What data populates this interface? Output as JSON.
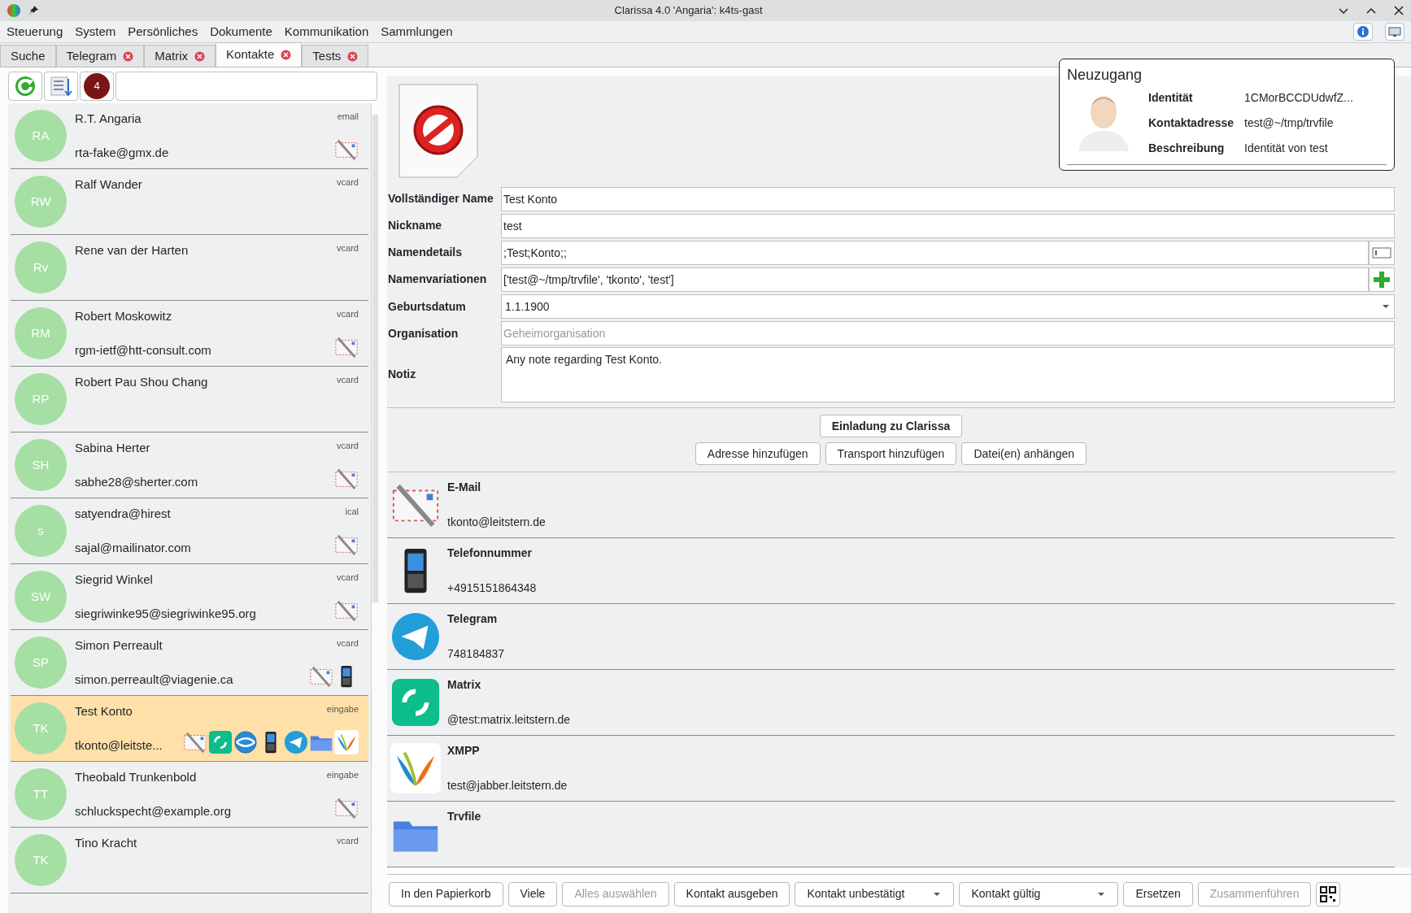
{
  "window": {
    "title": "Clarissa 4.0 'Angaria': k4ts-gast"
  },
  "menu": [
    "Steuerung",
    "System",
    "Persönliches",
    "Dokumente",
    "Kommunikation",
    "Sammlungen"
  ],
  "tabs": [
    {
      "label": "Suche",
      "closable": false,
      "selected": false
    },
    {
      "label": "Telegram",
      "closable": true,
      "selected": false
    },
    {
      "label": "Matrix",
      "closable": true,
      "selected": false
    },
    {
      "label": "Kontakte",
      "closable": true,
      "selected": true
    },
    {
      "label": "Tests",
      "closable": true,
      "selected": false
    }
  ],
  "toolbar": {
    "badge": "4"
  },
  "contacts": [
    {
      "initials": "RA",
      "name": "R.T. Angaria",
      "email": "rta-fake@gmx.de",
      "source": "email",
      "selected": false,
      "icons": [
        {
          "kind": "email"
        }
      ]
    },
    {
      "initials": "RW",
      "name": "Ralf Wander",
      "source": "vcard",
      "selected": false
    },
    {
      "initials": "Rv",
      "name": "Rene van der Harten",
      "source": "vcard",
      "selected": false
    },
    {
      "initials": "RM",
      "name": "Robert Moskowitz",
      "email": "rgm-ietf@htt-consult.com",
      "source": "vcard",
      "selected": false,
      "icons": [
        {
          "kind": "email"
        }
      ]
    },
    {
      "initials": "RP",
      "name": "Robert Pau Shou Chang",
      "source": "vcard",
      "selected": false
    },
    {
      "initials": "SH",
      "name": "Sabina Herter",
      "email": "sabhe28@sherter.com",
      "source": "vcard",
      "selected": false,
      "icons": [
        {
          "kind": "email"
        }
      ]
    },
    {
      "initials": "s",
      "name": "satyendra@hirest",
      "email": "sajal@mailinator.com",
      "source": "ical",
      "selected": false,
      "icons": [
        {
          "kind": "email"
        }
      ]
    },
    {
      "initials": "SW",
      "name": "Siegrid Winkel",
      "email": "siegriwinke95@siegriwinke95.org",
      "source": "vcard",
      "selected": false,
      "icons": [
        {
          "kind": "email"
        }
      ]
    },
    {
      "initials": "SP",
      "name": "Simon Perreault",
      "email": "simon.perreault@viagenie.ca",
      "source": "vcard",
      "selected": false,
      "icons": [
        {
          "kind": "email"
        },
        {
          "kind": "phone"
        }
      ]
    },
    {
      "initials": "TK",
      "name": "Test Konto",
      "email": "tkonto@leitste...",
      "source": "eingabe",
      "selected": true,
      "icons": [
        {
          "kind": "email"
        },
        {
          "kind": "matrix"
        },
        {
          "kind": "globe"
        },
        {
          "kind": "phone"
        },
        {
          "kind": "telegram"
        },
        {
          "kind": "folder"
        },
        {
          "kind": "xmpp"
        }
      ]
    },
    {
      "initials": "TT",
      "name": "Theobald Trunkenbold",
      "email": "schluckspecht@example.org",
      "source": "eingabe",
      "selected": false,
      "icons": [
        {
          "kind": "email"
        }
      ]
    },
    {
      "initials": "TK",
      "name": "Tino Kracht",
      "source": "vcard",
      "selected": false
    }
  ],
  "form": [
    {
      "kind": "text",
      "label": "Vollständiger Name",
      "value": "Test Konto"
    },
    {
      "kind": "text",
      "label": "Nickname",
      "value": "test"
    },
    {
      "kind": "card",
      "label": "Namendetails",
      "value": ";Test;Konto;;"
    },
    {
      "kind": "add",
      "label": "Namenvariationen",
      "value": "['test@~/tmp/trvfile', 'tkonto', 'test']"
    },
    {
      "kind": "dropdown",
      "label": "Geburtsdatum",
      "value": "1.1.1900"
    },
    {
      "kind": "text",
      "label": "Organisation",
      "placeholder": "Geheimorganisation"
    },
    {
      "kind": "textarea",
      "label": "Notiz",
      "value": "Any note regarding Test Konto."
    }
  ],
  "invite_button": "Einladung zu Clarissa",
  "action_buttons": [
    "Adresse hinzufügen",
    "Transport hinzufügen",
    "Datei(en) anhängen"
  ],
  "transports": [
    {
      "kind": "email",
      "title": "E-Mail",
      "value": "tkonto@leitstern.de"
    },
    {
      "kind": "phone",
      "title": "Telefonnummer",
      "value": "+4915151864348"
    },
    {
      "kind": "telegram",
      "title": "Telegram",
      "value": "748184837"
    },
    {
      "kind": "matrix",
      "title": "Matrix",
      "value": "@test:matrix.leitstern.de"
    },
    {
      "kind": "xmpp",
      "title": "XMPP",
      "value": "test@jabber.leitstern.de"
    },
    {
      "kind": "folder",
      "title": "Trvfile"
    }
  ],
  "bottom_buttons": [
    {
      "kind": "button",
      "label": "In den Papierkorb",
      "disabled": false
    },
    {
      "kind": "button",
      "label": "Viele",
      "disabled": false
    },
    {
      "kind": "button",
      "label": "Alles auswählen",
      "disabled": true
    },
    {
      "kind": "button",
      "label": "Kontakt ausgeben",
      "disabled": false
    },
    {
      "kind": "dropdown",
      "label": "Kontakt unbestätigt",
      "disabled": false
    },
    {
      "kind": "dropdown",
      "label": "Kontakt gültig",
      "disabled": false
    },
    {
      "kind": "button",
      "label": "Ersetzen",
      "disabled": false
    },
    {
      "kind": "button",
      "label": "Zusammenführen",
      "disabled": true
    }
  ],
  "popup": {
    "title": "Neuzugang",
    "rows": [
      {
        "label": "Identität",
        "value": "1CMorBCCDUdwfZ..."
      },
      {
        "label": "Kontaktadresse",
        "value": "test@~/tmp/trvfile"
      },
      {
        "label": "Beschreibung",
        "value": "Identität von test"
      }
    ]
  }
}
